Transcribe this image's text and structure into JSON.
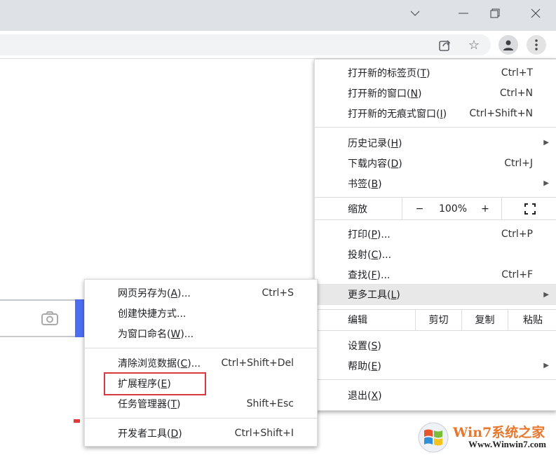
{
  "window": {
    "tab_search": "chevron-down",
    "minimize": "minimize",
    "restore": "restore",
    "close": "close"
  },
  "main_menu": {
    "group1": [
      {
        "label": "打开新的标签页(",
        "key": "T",
        "shortcut": "Ctrl+T"
      },
      {
        "label": "打开新的窗口(",
        "key": "N",
        "shortcut": "Ctrl+N"
      },
      {
        "label": "打开新的无痕式窗口(",
        "key": "I",
        "shortcut": "Ctrl+Shift+N"
      }
    ],
    "group2": [
      {
        "label": "历史记录(",
        "key": "H"
      },
      {
        "label": "下载内容(",
        "key": "D",
        "shortcut": "Ctrl+J"
      },
      {
        "label": "书签(",
        "key": "B"
      }
    ],
    "zoom": {
      "label": "缩放",
      "minus": "−",
      "value": "100%",
      "plus": "+"
    },
    "group3": [
      {
        "label": "打印(",
        "key": "P",
        "suffix": ")...",
        "shortcut": "Ctrl+P"
      },
      {
        "label": "投射(",
        "key": "C",
        "suffix": ")..."
      },
      {
        "label": "查找(",
        "key": "F",
        "suffix": ")...",
        "shortcut": "Ctrl+F"
      },
      {
        "label": "更多工具(",
        "key": "L",
        "suffix": ")"
      }
    ],
    "edit": {
      "label": "编辑",
      "cut": "剪切",
      "copy": "复制",
      "paste": "粘贴"
    },
    "group4": [
      {
        "label": "设置(",
        "key": "S"
      },
      {
        "label": "帮助(",
        "key": "E"
      }
    ],
    "exit": {
      "label": "退出(",
      "key": "X"
    }
  },
  "sub_menu": {
    "items": [
      {
        "label": "网页另存为(",
        "key": "A",
        "suffix": ")...",
        "shortcut": "Ctrl+S"
      },
      {
        "label": "创建快捷方式..."
      },
      {
        "label": "为窗口命名(",
        "key": "W",
        "suffix": ")..."
      },
      {
        "label": "清除浏览数据(",
        "key": "C",
        "suffix": ")...",
        "shortcut": "Ctrl+Shift+Del"
      },
      {
        "label": "扩展程序(",
        "key": "E",
        "suffix": ")"
      },
      {
        "label": "任务管理器(",
        "key": "T",
        "suffix": ")",
        "shortcut": "Shift+Esc"
      },
      {
        "label": "开发者工具(",
        "key": "D",
        "suffix": ")",
        "shortcut": "Ctrl+Shift+I"
      }
    ]
  },
  "watermark": {
    "brand": "Win7系统之家",
    "url": "Www.Winwin7.com"
  },
  "colors": {
    "highlight_box": "#d9393e",
    "search_button": "#4e6ef2"
  }
}
